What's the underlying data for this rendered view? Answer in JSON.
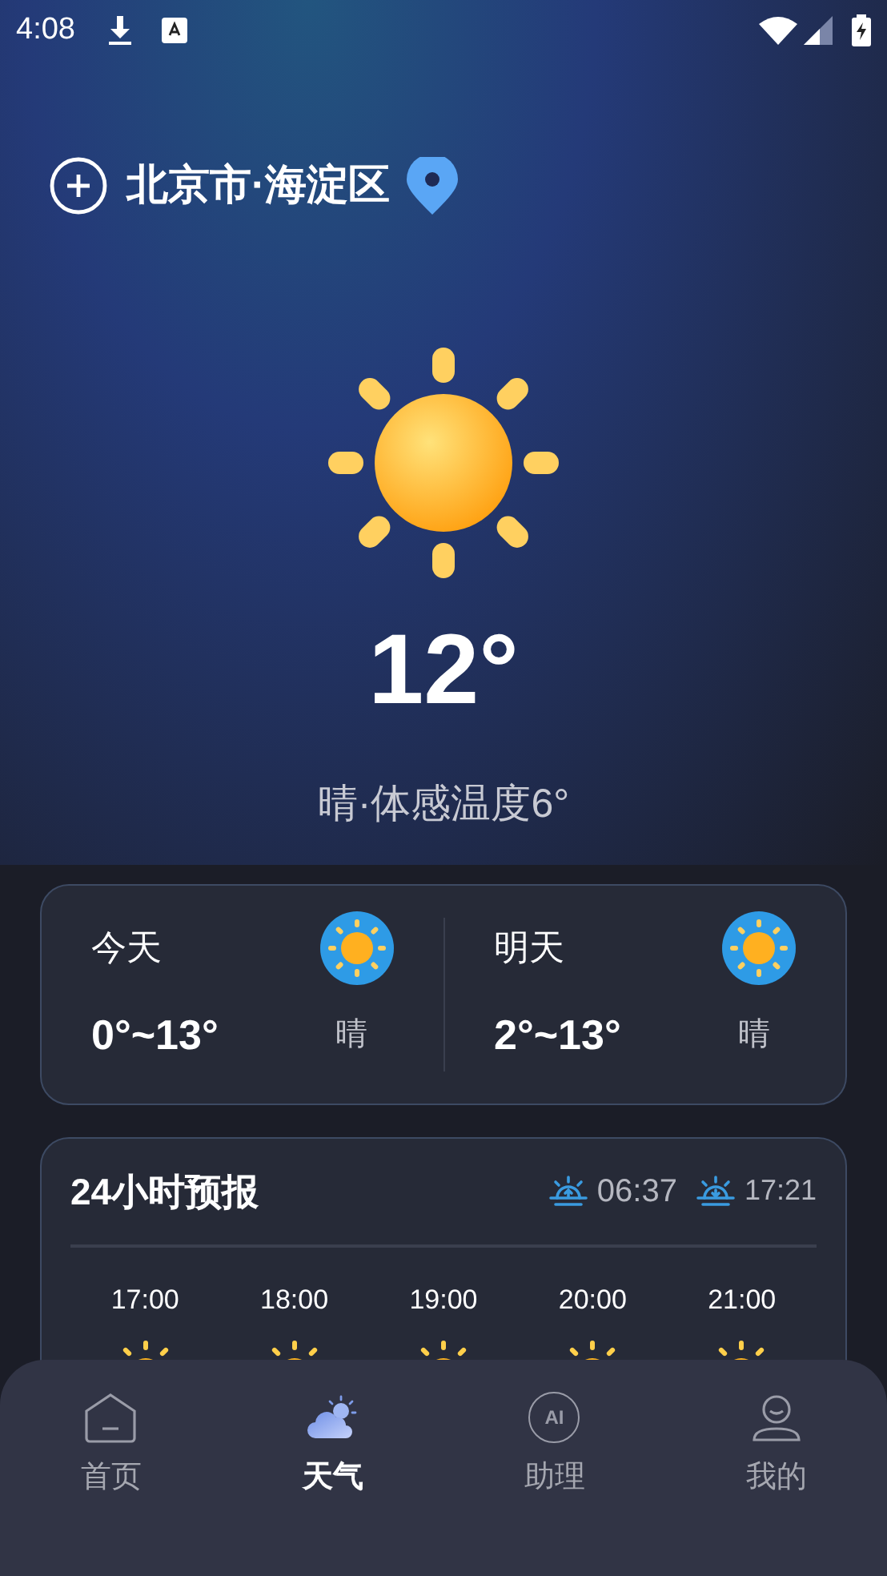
{
  "status_bar": {
    "time": "4:08"
  },
  "location": {
    "name": "北京市·海淀区"
  },
  "current": {
    "temperature": "12°",
    "summary": "晴·体感温度6°"
  },
  "days": [
    {
      "label": "今天",
      "range": "0°~13°",
      "condition": "晴"
    },
    {
      "label": "明天",
      "range": "2°~13°",
      "condition": "晴"
    }
  ],
  "hourly": {
    "title": "24小时预报",
    "sunrise": "06:37",
    "sunset": "17:21",
    "hours": [
      {
        "time": "17:00"
      },
      {
        "time": "18:00"
      },
      {
        "time": "19:00"
      },
      {
        "time": "20:00"
      },
      {
        "time": "21:00"
      }
    ]
  },
  "nav": [
    {
      "label": "首页",
      "kind": "home",
      "selected": false
    },
    {
      "label": "天气",
      "kind": "weather",
      "selected": true
    },
    {
      "label": "助理",
      "kind": "ai",
      "icon_text": "AI",
      "selected": false
    },
    {
      "label": "我的",
      "kind": "profile",
      "selected": false
    }
  ]
}
